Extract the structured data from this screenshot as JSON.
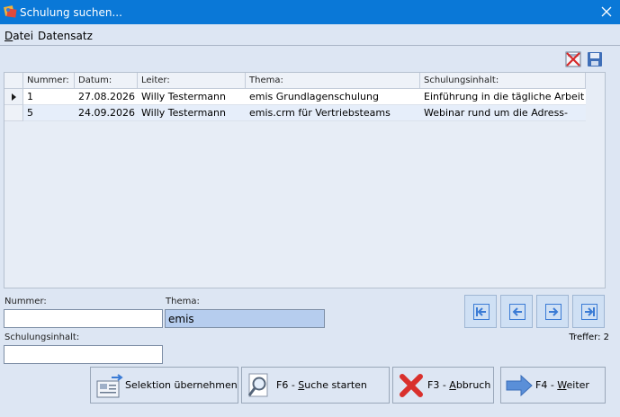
{
  "window": {
    "title": "Schulung suchen..."
  },
  "menu": [
    {
      "label": "Datei",
      "key": "D",
      "rest": "atei"
    },
    {
      "label": "Datensatz",
      "key": "",
      "rest": "Datensatz"
    }
  ],
  "grid": {
    "columns": [
      "Nummer:",
      "Datum:",
      "Leiter:",
      "Thema:",
      "Schulungsinhalt:"
    ],
    "rows": [
      {
        "nummer": "1",
        "datum": "27.08.2026",
        "leiter": "Willy Testermann",
        "thema": "emis Grundlagenschulung",
        "inhalt": "Einführung in die tägliche Arbeit"
      },
      {
        "nummer": "5",
        "datum": "24.09.2026",
        "leiter": "Willy Testermann",
        "thema": "emis.crm für Vertriebsteams",
        "inhalt": "Webinar rund um die Adress-"
      }
    ]
  },
  "form": {
    "nummer_label": "Nummer:",
    "nummer_value": "",
    "thema_label": "Thema:",
    "thema_value": "emis",
    "inhalt_label": "Schulungsinhalt:",
    "inhalt_value": ""
  },
  "treffer": "Treffer: 2",
  "buttons": {
    "selektion": "Selektion übernehmen",
    "suche_pre": "F6 - ",
    "suche_key": "S",
    "suche_post": "uche starten",
    "abbruch_pre": "F3 - ",
    "abbruch_key": "A",
    "abbruch_post": "bbruch",
    "weiter_pre": "F4 - ",
    "weiter_key": "W",
    "weiter_post": "eiter"
  },
  "colors": {
    "titlebar": "#0a78d7",
    "background": "#dde6f3",
    "active_field": "#b6cdee"
  }
}
